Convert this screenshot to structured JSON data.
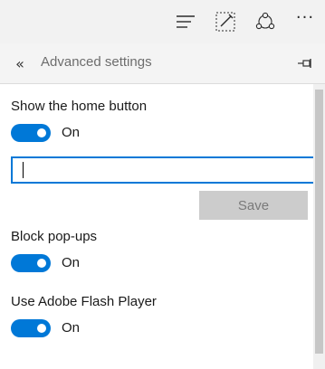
{
  "toolbar": {
    "hub_icon": "hub-icon",
    "note_icon": "web-note-icon",
    "share_icon": "share-icon",
    "more_label": "···"
  },
  "panel": {
    "back_label": "«",
    "title": "Advanced settings",
    "pin_icon": "pin-icon"
  },
  "settings": {
    "home_button": {
      "label": "Show the home button",
      "state": "On",
      "url_value": "",
      "save_label": "Save"
    },
    "popups": {
      "label": "Block pop-ups",
      "state": "On"
    },
    "flash": {
      "label": "Use Adobe Flash Player",
      "state": "On"
    }
  },
  "colors": {
    "accent": "#0078d7",
    "toolbar_bg": "#f2f2f2",
    "save_disabled_bg": "#cccccc"
  }
}
